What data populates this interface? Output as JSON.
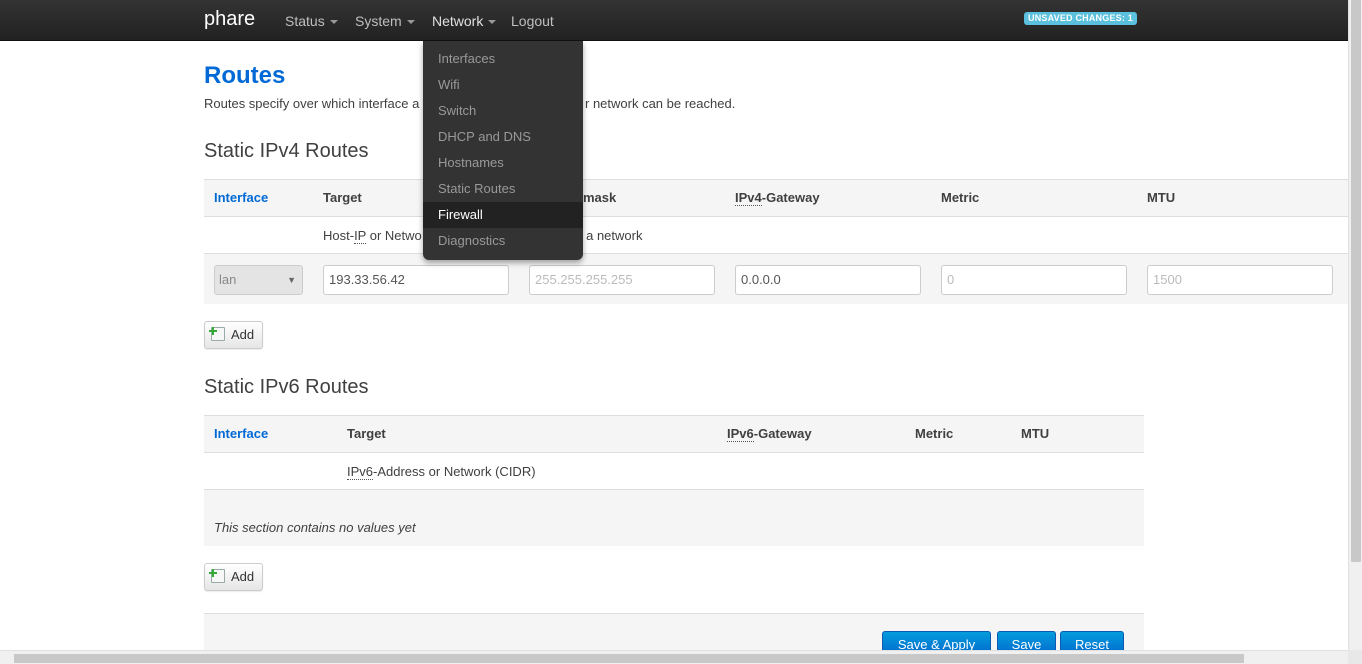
{
  "nav": {
    "brand": "phare",
    "status": "Status",
    "system": "System",
    "network": "Network",
    "logout": "Logout",
    "unsaved": "UNSAVED CHANGES: 1"
  },
  "network_menu": [
    "Interfaces",
    "Wifi",
    "Switch",
    "DHCP and DNS",
    "Hostnames",
    "Static Routes",
    "Firewall",
    "Diagnostics"
  ],
  "page": {
    "title": "Routes",
    "desc_left": "Routes specify over which interface a",
    "desc_right": "r network can be reached."
  },
  "ipv4": {
    "title": "Static IPv4 Routes",
    "headers": {
      "interface": "Interface",
      "target": "Target",
      "netmask_partial": "mask",
      "gateway_abbr": "IPv4",
      "gateway_rest": "-Gateway",
      "metric": "Metric",
      "mtu": "MTU"
    },
    "desc_target_pre": "Host-",
    "desc_target_abbr": "IP",
    "desc_target_post": " or Netwo",
    "desc_netmask_partial": "s a network",
    "row": {
      "interface": "lan",
      "target": "193.33.56.42",
      "netmask_placeholder": "255.255.255.255",
      "gateway": "0.0.0.0",
      "metric_placeholder": "0",
      "mtu_placeholder": "1500"
    },
    "add": "Add"
  },
  "ipv6": {
    "title": "Static IPv6 Routes",
    "headers": {
      "interface": "Interface",
      "target": "Target",
      "gateway_abbr": "IPv6",
      "gateway_rest": "-Gateway",
      "metric": "Metric",
      "mtu": "MTU"
    },
    "desc_target_abbr": "IPv6",
    "desc_target_rest": "-Address or Network (CIDR)",
    "empty": "This section contains no values yet",
    "add": "Add"
  },
  "actions": {
    "save_apply": "Save & Apply",
    "save": "Save",
    "reset": "Reset"
  }
}
